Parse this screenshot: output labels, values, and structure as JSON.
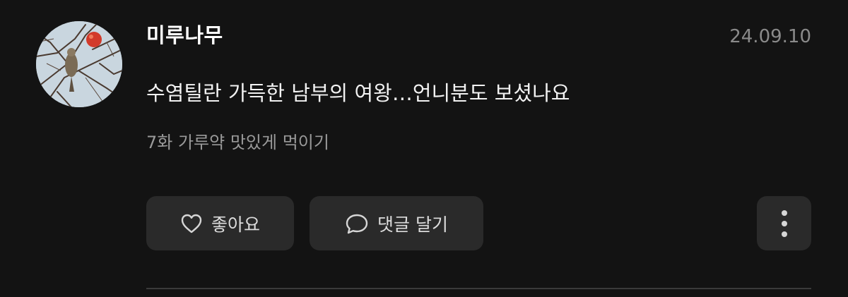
{
  "comment": {
    "username": "미루나무",
    "date": "24.09.10",
    "text": "수염틸란 가득한 남부의 여왕…언니분도 보셨나요",
    "episode": "7화 가루약 맛있게 먹이기"
  },
  "actions": {
    "like_label": "좋아요",
    "reply_label": "댓글 달기"
  },
  "icons": {
    "like": "heart-outline-icon",
    "reply": "speech-bubble-icon",
    "more": "vertical-ellipsis-icon"
  },
  "colors": {
    "background": "#131313",
    "button": "#2a2a2a",
    "muted_text": "#8a8a8a",
    "primary_text": "#ffffff"
  }
}
